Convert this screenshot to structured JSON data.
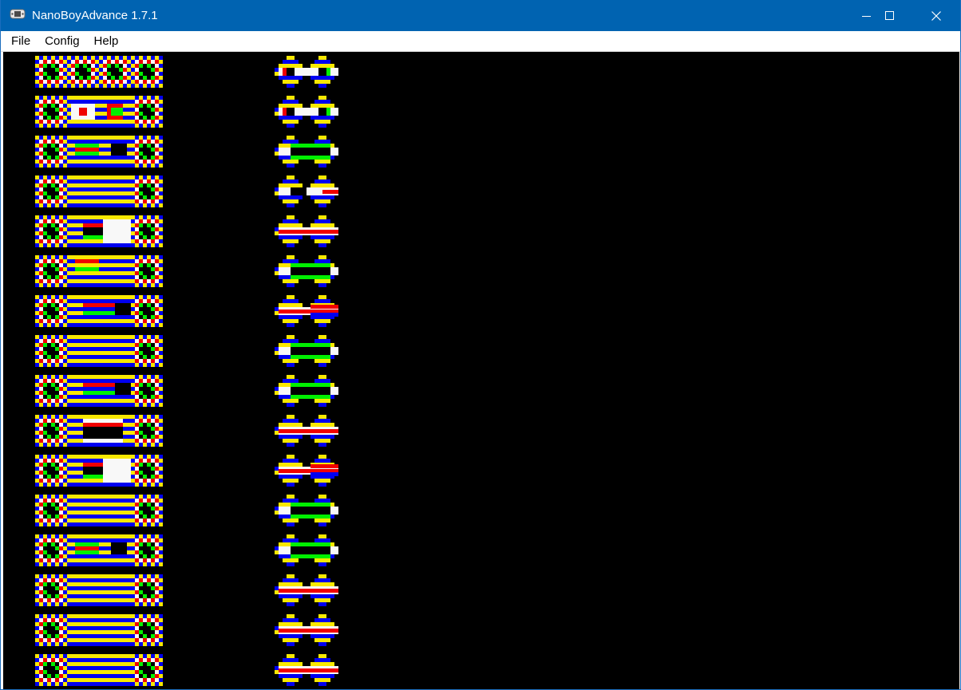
{
  "window": {
    "title": "NanoBoyAdvance 1.7.1",
    "icon": "gameboy-advance-icon",
    "controls": {
      "minimize": "minimize-icon",
      "maximize": "maximize-icon",
      "close": "close-icon"
    }
  },
  "menu": {
    "items": [
      {
        "label": "File"
      },
      {
        "label": "Config"
      },
      {
        "label": "Help"
      }
    ]
  },
  "screen": {
    "background": "#000000",
    "palette": {
      "blue": "#0000f0",
      "yellow": "#f8e800",
      "white": "#f8f8f8",
      "red": "#f00000",
      "green": "#00f000",
      "black": "#000000"
    },
    "left_column_variants": [
      "q",
      "h",
      "m",
      "s",
      "w",
      "r",
      "x",
      "s",
      "x",
      "b",
      "w",
      "s",
      "m",
      "s",
      "s",
      "s"
    ],
    "right_column_variants": [
      "e",
      "e",
      "g",
      "r",
      "w",
      "g",
      "rr",
      "g",
      "g",
      "w",
      "rr",
      "g",
      "g",
      "w",
      "w",
      "w"
    ]
  }
}
